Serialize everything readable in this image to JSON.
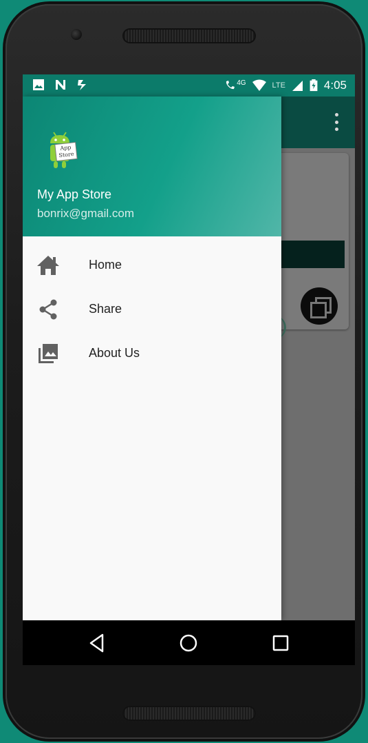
{
  "status_bar": {
    "time": "4:05",
    "network": "4G",
    "lte_label": "LTE",
    "left_icons": [
      "image-icon",
      "n-icon",
      "download-check-icon"
    ],
    "right_icons": [
      "wifi-call-icon",
      "wifi-icon",
      "signal-icon",
      "battery-charging-icon"
    ]
  },
  "drawer": {
    "header": {
      "logo_text": "App Store",
      "app_name": "My App Store",
      "email": "bonrix@gmail.com"
    },
    "items": [
      {
        "label": "Home",
        "icon": "home-icon"
      },
      {
        "label": "Share",
        "icon": "share-icon"
      },
      {
        "label": "About Us",
        "icon": "photo-library-icon"
      }
    ]
  },
  "background_app": {
    "overflow_menu_icon": "more-vert-icon"
  },
  "nav_bar": {
    "buttons": [
      "back-icon",
      "home-circle-icon",
      "recents-icon"
    ]
  },
  "colors": {
    "primary": "#0c8674",
    "background": "#0f8a76",
    "drawer_bg": "#f9f9f9"
  }
}
